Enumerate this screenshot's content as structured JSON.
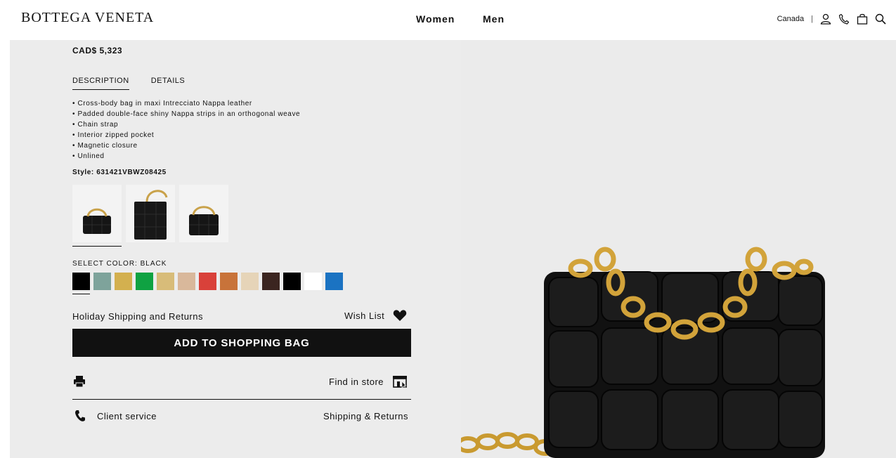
{
  "header": {
    "logo": "BOTTEGA VENETA",
    "nav": [
      "Women",
      "Men"
    ],
    "country": "Canada",
    "separator": "|"
  },
  "product": {
    "price": "CAD$ 5,323",
    "tabs": [
      "DESCRIPTION",
      "DETAILS"
    ],
    "description": [
      "• Cross-body bag in maxi Intrecciato Nappa leather",
      "• Padded double-face shiny Nappa strips in an orthogonal weave",
      "• Chain strap",
      "• Interior zipped pocket",
      "• Magnetic closure",
      "• Unlined"
    ],
    "style": "Style: 631421VBWZ08425",
    "select_color_label": "SELECT COLOR: BLACK",
    "swatches": [
      "#000000",
      "#7ea39b",
      "#d3b04f",
      "#0fa242",
      "#d8bc79",
      "#d9b89b",
      "#d9413a",
      "#c8733a",
      "#e6d4b8",
      "#3b2520",
      "#000000",
      "#ffffff",
      "#1b73c2"
    ],
    "holiday": "Holiday Shipping and Returns",
    "wishlist": "Wish List",
    "add_to_bag": "ADD TO SHOPPING BAG",
    "find_in_store": "Find in store",
    "client_service": "Client service",
    "shipping_returns": "Shipping & Returns"
  },
  "icons": [
    "user-icon",
    "phone-icon",
    "bag-icon",
    "search-icon",
    "heart-icon",
    "print-icon",
    "store-icon",
    "phone-handset-icon"
  ]
}
